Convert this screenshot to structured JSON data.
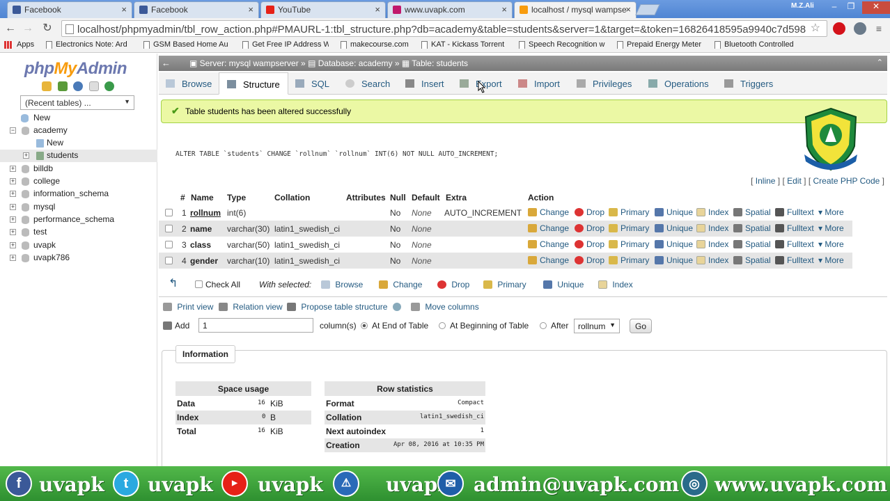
{
  "browser": {
    "tabs": [
      {
        "title": "Facebook",
        "color": "#3b5998"
      },
      {
        "title": "Facebook",
        "color": "#3b5998"
      },
      {
        "title": "YouTube",
        "color": "#e62117"
      },
      {
        "title": "www.uvapk.com",
        "color": "#c0186c"
      },
      {
        "title": "localhost / mysql wampse",
        "color": "#f89c0e"
      }
    ],
    "user": "M.Z.Ali",
    "url": "localhost/phpmyadmin/tbl_row_action.php#PMAURL-1:tbl_structure.php?db=academy&table=students&server=1&target=&token=16826418595a9940c7d598",
    "bookmarks": [
      "Apps",
      "Electronics Note: Ard",
      "GSM Based Home Au",
      "Get Free IP Address W",
      "makecourse.com",
      "KAT - Kickass Torrent",
      "Speech Recognition w",
      "Prepaid Energy Meter",
      "Bluetooth Controlled"
    ]
  },
  "sidebar": {
    "logo_php": "php",
    "logo_my": "My",
    "logo_admin": "Admin",
    "recent": "(Recent tables) ...",
    "tree": {
      "new": "New",
      "academy": "academy",
      "academy_new": "New",
      "students": "students",
      "dbs": [
        "billdb",
        "college",
        "information_schema",
        "mysql",
        "performance_schema",
        "test",
        "uvapk",
        "uvapk786"
      ]
    }
  },
  "breadcrumb": {
    "server": "Server: mysql wampserver",
    "database": "Database: academy",
    "table": "Table: students"
  },
  "menu": [
    "Browse",
    "Structure",
    "SQL",
    "Search",
    "Insert",
    "Export",
    "Import",
    "Privileges",
    "Operations",
    "Triggers"
  ],
  "message": "Table students has been altered successfully",
  "sql": "ALTER TABLE `students` CHANGE `rollnum` `rollnum` INT(6) NOT NULL AUTO_INCREMENT;",
  "query_links": {
    "inline": "Inline",
    "edit": "Edit",
    "create_php": "Create PHP Code"
  },
  "columns_header": [
    "#",
    "Name",
    "Type",
    "Collation",
    "Attributes",
    "Null",
    "Default",
    "Extra",
    "Action"
  ],
  "rows": [
    {
      "num": "1",
      "name": "rollnum",
      "type": "int(6)",
      "collation": "",
      "null": "No",
      "default": "None",
      "extra": "AUTO_INCREMENT"
    },
    {
      "num": "2",
      "name": "name",
      "type": "varchar(30)",
      "collation": "latin1_swedish_ci",
      "null": "No",
      "default": "None",
      "extra": ""
    },
    {
      "num": "3",
      "name": "class",
      "type": "varchar(50)",
      "collation": "latin1_swedish_ci",
      "null": "No",
      "default": "None",
      "extra": ""
    },
    {
      "num": "4",
      "name": "gender",
      "type": "varchar(10)",
      "collation": "latin1_swedish_ci",
      "null": "No",
      "default": "None",
      "extra": ""
    }
  ],
  "row_actions": [
    "Change",
    "Drop",
    "Primary",
    "Unique",
    "Index",
    "Spatial",
    "Fulltext",
    "More"
  ],
  "bulk": {
    "check_all": "Check All",
    "with_selected": "With selected:",
    "actions": [
      "Browse",
      "Change",
      "Drop",
      "Primary",
      "Unique",
      "Index"
    ]
  },
  "tools": [
    "Print view",
    "Relation view",
    "Propose table structure",
    "Move columns"
  ],
  "add_row": {
    "add": "Add",
    "count": "1",
    "columns": "column(s)",
    "end": "At End of Table",
    "beginning": "At Beginning of Table",
    "after": "After",
    "after_col": "rollnum",
    "go": "Go"
  },
  "information": {
    "legend": "Information",
    "space_title": "Space usage",
    "space": [
      {
        "k": "Data",
        "v": "16",
        "u": "KiB"
      },
      {
        "k": "Index",
        "v": "0",
        "u": "B"
      },
      {
        "k": "Total",
        "v": "16",
        "u": "KiB"
      }
    ],
    "row_title": "Row statistics",
    "rowstats": [
      {
        "k": "Format",
        "v": "Compact"
      },
      {
        "k": "Collation",
        "v": "latin1_swedish_ci"
      },
      {
        "k": "Next autoindex",
        "v": "1"
      },
      {
        "k": "Creation",
        "v": "Apr 08, 2016 at 10:35 PM"
      }
    ]
  },
  "banner": [
    "uvapk",
    "uvapk",
    "uvapk",
    "uvapk",
    "admin@uvapk.com",
    "www.uvapk.com"
  ]
}
